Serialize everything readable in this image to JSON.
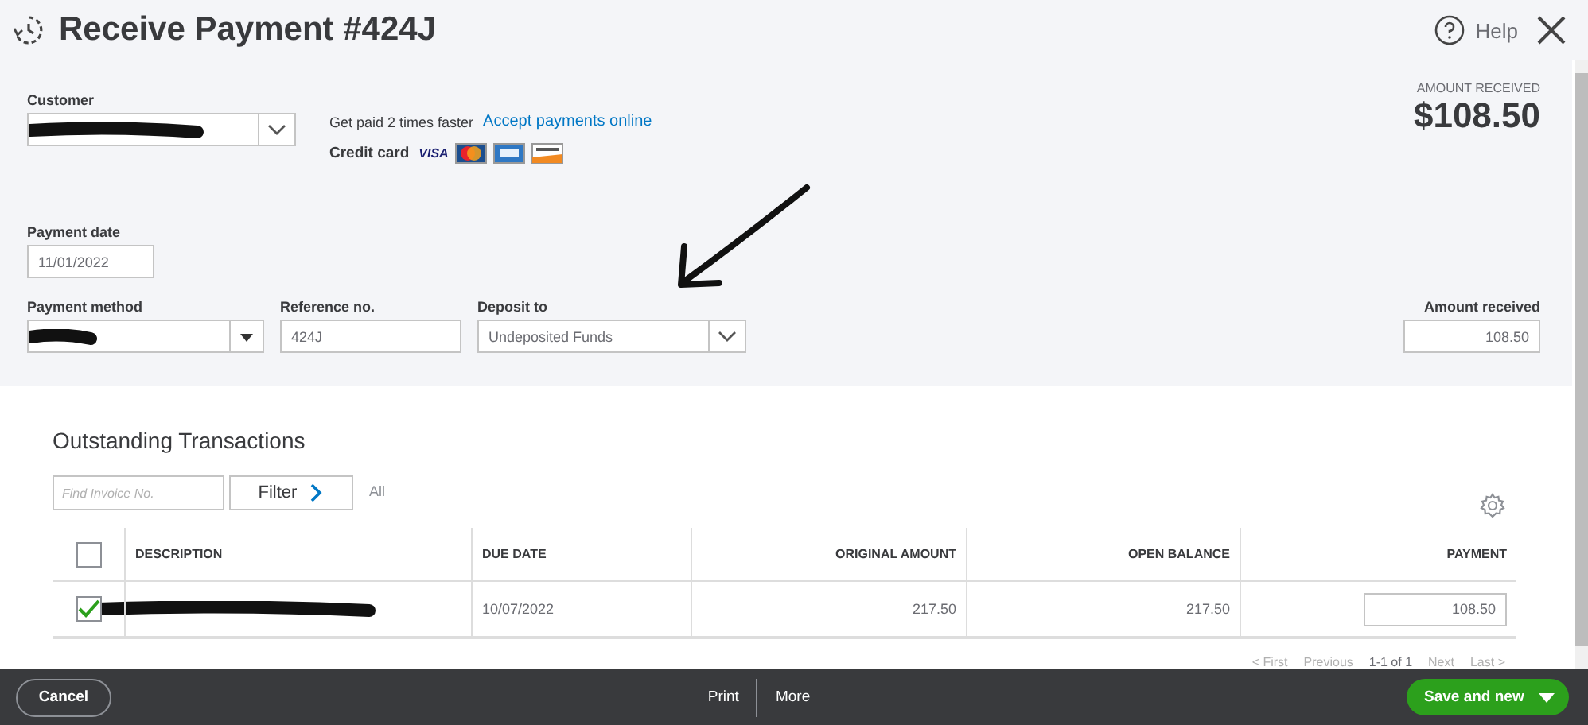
{
  "header": {
    "title": "Receive Payment #424J",
    "help": "Help"
  },
  "customer": {
    "label": "Customer"
  },
  "promo": {
    "text": "Get paid 2 times faster",
    "link": "Accept payments online",
    "cards_label": "Credit card",
    "visa": "VISA"
  },
  "amount": {
    "label": "AMOUNT RECEIVED",
    "value": "$108.50"
  },
  "payment_date": {
    "label": "Payment date",
    "value": "11/01/2022"
  },
  "payment_method": {
    "label": "Payment method"
  },
  "reference": {
    "label": "Reference no.",
    "value": "424J"
  },
  "deposit_to": {
    "label": "Deposit to",
    "value": "Undeposited Funds"
  },
  "amount_received": {
    "label": "Amount received",
    "value": "108.50"
  },
  "transactions": {
    "title": "Outstanding Transactions",
    "search": {
      "placeholder": "Find Invoice No."
    },
    "filter": "Filter",
    "filter_value": "All",
    "columns": [
      "DESCRIPTION",
      "DUE DATE",
      "ORIGINAL AMOUNT",
      "OPEN BALANCE",
      "PAYMENT"
    ],
    "select_all": {
      "checked": false
    },
    "rows": [
      {
        "checked": true,
        "due_date": "10/07/2022",
        "original_amount": "217.50",
        "open_balance": "217.50",
        "payment": "108.50"
      }
    ],
    "pagination": {
      "first": "< First",
      "previous": "Previous",
      "range": "1-1 of 1",
      "next": "Next",
      "last": "Last >"
    }
  },
  "footer": {
    "cancel": "Cancel",
    "print": "Print",
    "more": "More",
    "save": "Save and new"
  }
}
